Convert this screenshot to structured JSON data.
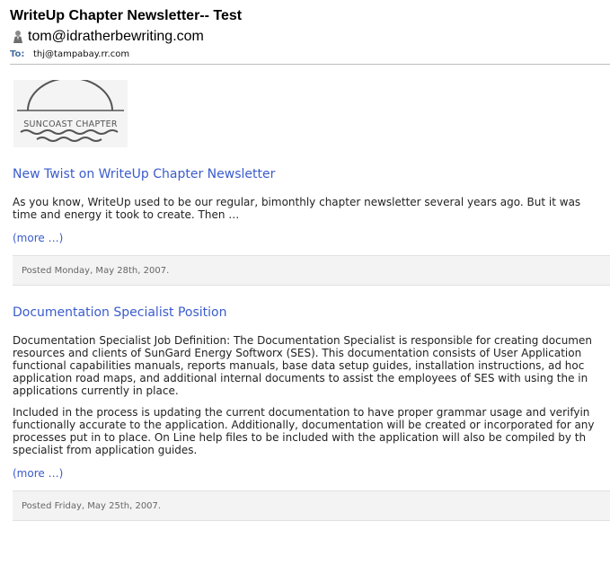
{
  "email": {
    "subject": "WriteUp Chapter Newsletter-- Test",
    "from": "tom@idratherbewriting.com",
    "to_label": "To:",
    "to_value": "thj@tampabay.rr.com"
  },
  "logo": {
    "text": "SUNCOAST CHAPTER"
  },
  "posts": [
    {
      "title": "New Twist on WriteUp Chapter Newsletter",
      "paragraphs": [
        [
          "As you know, WriteUp used to be our regular, bimonthly chapter newsletter several years ago. But it was",
          "time and energy it took to create. Then …"
        ]
      ],
      "more": "(more …)",
      "posted": "Posted Monday, May 28th, 2007."
    },
    {
      "title": "Documentation Specialist Position",
      "paragraphs": [
        [
          "Documentation Specialist Job Definition: The Documentation Specialist is responsible for creating documen",
          "resources and clients of SunGard Energy Softworx (SES). This documentation consists of User Application",
          "functional capabilities manuals, reports manuals, base data setup guides, installation instructions, ad hoc",
          "application road maps, and additional internal documents to assist the employees of SES with using the in",
          "applications currently in place."
        ],
        [
          "Included in the process is updating the current documentation to have proper grammar usage and verifyin",
          "functionally accurate to the application. Additionally, documentation will be created or incorporated for any",
          "processes put in to place. On Line help files to be included with the application will also be compiled by th",
          "specialist from application guides."
        ]
      ],
      "more": "(more …)",
      "posted": "Posted Friday, May 25th, 2007."
    }
  ]
}
